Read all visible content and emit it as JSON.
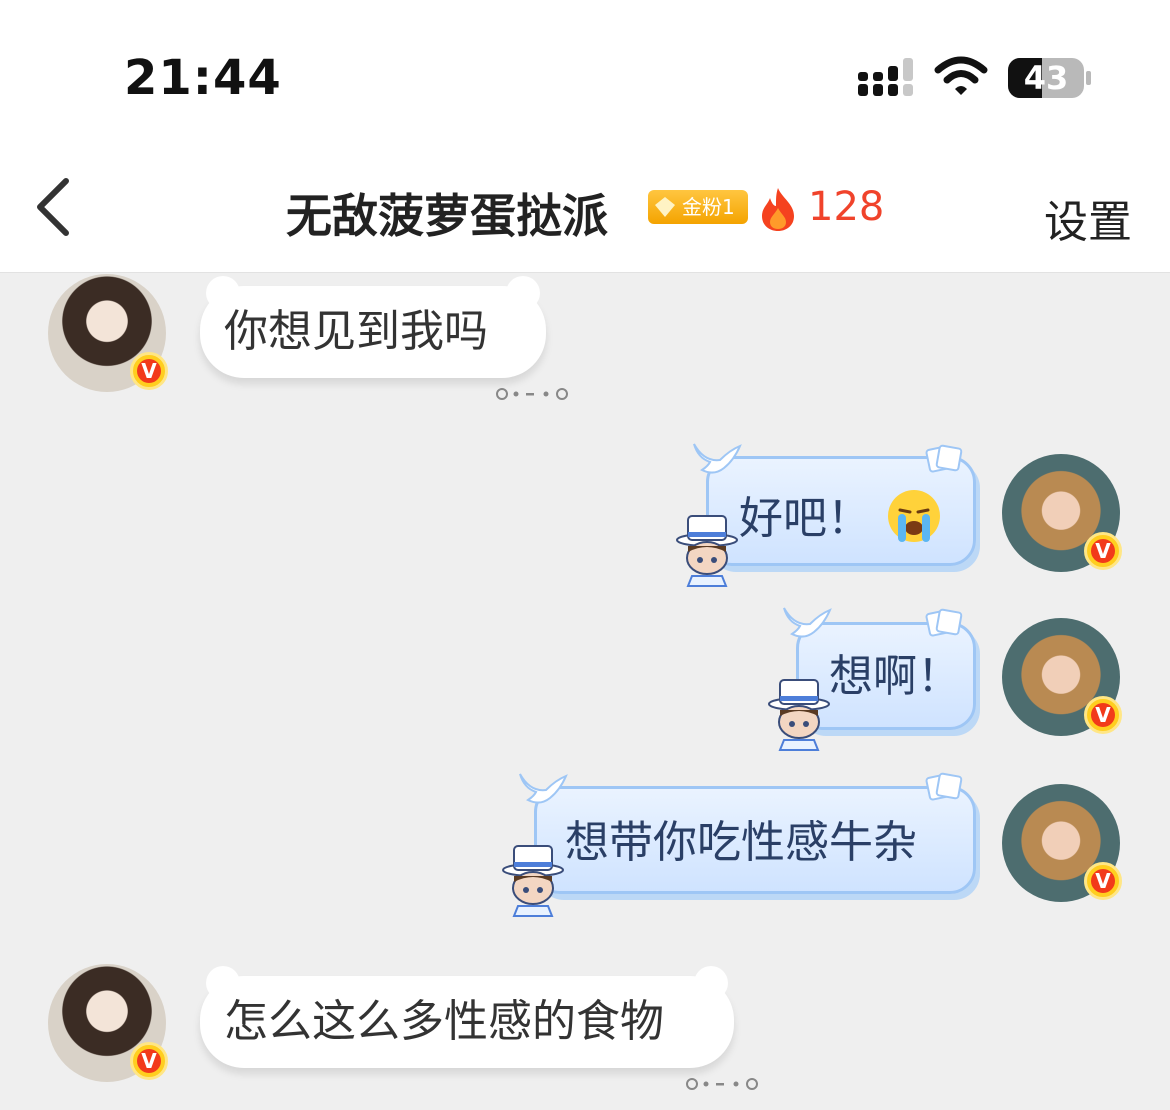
{
  "status_bar": {
    "time": "21:44",
    "battery_level": "43"
  },
  "header": {
    "back_icon": "chevron-left-icon",
    "title": "无敌菠萝蛋挞派",
    "fan_badge": "金粉1",
    "heat_count": "128",
    "settings_label": "设置"
  },
  "colors": {
    "heat": "#f0432b",
    "fan_badge": "#f4a300",
    "outgoing_bubble_border": "#9ec6f5",
    "verified_badge": "#f23a1a"
  },
  "messages": [
    {
      "side": "incoming",
      "text": "你想见到我吗",
      "read_status_icon": "read-dots-icon"
    },
    {
      "side": "outgoing",
      "text": "好吧！",
      "emoji": "crying-face-emoji"
    },
    {
      "side": "outgoing",
      "text": "想啊！"
    },
    {
      "side": "outgoing",
      "text": "想带你吃性感牛杂"
    },
    {
      "side": "incoming",
      "text": "怎么这么多性感的食物",
      "read_status_icon": "read-dots-icon"
    }
  ],
  "verified_badge_letter": "V"
}
